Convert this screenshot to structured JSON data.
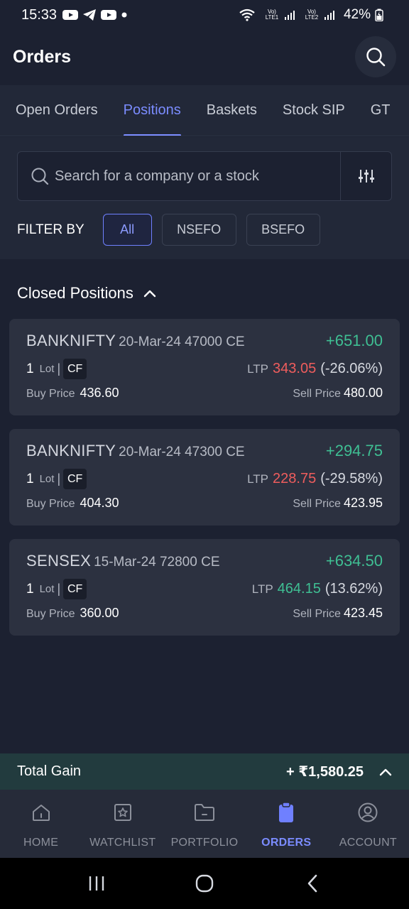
{
  "status_bar": {
    "time": "15:33",
    "net1": "Vo) LTE1",
    "net2": "Vo) LTE2",
    "battery": "42%"
  },
  "header": {
    "title": "Orders"
  },
  "tabs": [
    {
      "label": "Open Orders",
      "active": false
    },
    {
      "label": "Positions",
      "active": true
    },
    {
      "label": "Baskets",
      "active": false
    },
    {
      "label": "Stock SIP",
      "active": false
    },
    {
      "label": "GT",
      "active": false
    }
  ],
  "search": {
    "placeholder": "Search for a company or a stock"
  },
  "filter": {
    "label": "FILTER BY",
    "chips": [
      {
        "label": "All",
        "active": true
      },
      {
        "label": "NSEFO",
        "active": false
      },
      {
        "label": "BSEFO",
        "active": false
      }
    ]
  },
  "section": {
    "title": "Closed Positions"
  },
  "positions": [
    {
      "symbol": "BANKNIFTY",
      "contract": "20-Mar-24 47000 CE",
      "pnl": "+651.00",
      "lots": "1",
      "lot_word": "Lot",
      "badge": "CF",
      "ltp_label": "LTP",
      "ltp": "343.05",
      "ltp_change": "(-26.06%)",
      "ltp_direction": "down",
      "buy_label": "Buy Price",
      "buy_price": "436.60",
      "sell_label": "Sell Price",
      "sell_price": "480.00"
    },
    {
      "symbol": "BANKNIFTY",
      "contract": "20-Mar-24 47300 CE",
      "pnl": "+294.75",
      "lots": "1",
      "lot_word": "Lot",
      "badge": "CF",
      "ltp_label": "LTP",
      "ltp": "228.75",
      "ltp_change": "(-29.58%)",
      "ltp_direction": "down",
      "buy_label": "Buy Price",
      "buy_price": "404.30",
      "sell_label": "Sell Price",
      "sell_price": "423.95"
    },
    {
      "symbol": "SENSEX",
      "contract": "15-Mar-24 72800 CE",
      "pnl": "+634.50",
      "lots": "1",
      "lot_word": "Lot",
      "badge": "CF",
      "ltp_label": "LTP",
      "ltp": "464.15",
      "ltp_change": "(13.62%)",
      "ltp_direction": "up",
      "buy_label": "Buy Price",
      "buy_price": "360.00",
      "sell_label": "Sell Price",
      "sell_price": "423.45"
    }
  ],
  "total": {
    "label": "Total Gain",
    "value": "+ ₹1,580.25"
  },
  "bottom_nav": [
    {
      "label": "HOME",
      "icon": "home-icon",
      "active": false
    },
    {
      "label": "WATCHLIST",
      "icon": "watchlist-icon",
      "active": false
    },
    {
      "label": "PORTFOLIO",
      "icon": "portfolio-icon",
      "active": false
    },
    {
      "label": "ORDERS",
      "icon": "orders-icon",
      "active": true
    },
    {
      "label": "ACCOUNT",
      "icon": "account-icon",
      "active": false
    }
  ],
  "colors": {
    "accent": "#7b8cff",
    "gain": "#3fbf93",
    "loss": "#ef5d5d",
    "background": "#1c2131",
    "card": "#2c3140"
  }
}
